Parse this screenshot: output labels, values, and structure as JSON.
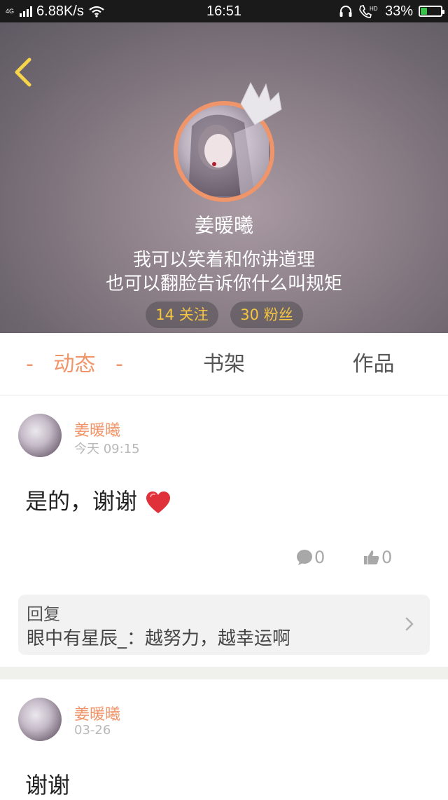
{
  "status_bar": {
    "network": "4G",
    "speed": "6.88K/s",
    "time": "16:51",
    "battery_percent": "33%",
    "battery_level": 0.33,
    "icons": [
      "signal-icon",
      "wifi-icon",
      "headset-icon",
      "hd-call-icon",
      "battery-icon"
    ]
  },
  "profile": {
    "name": "姜暖曦",
    "bio_line1": "我可以笑着和你讲道理",
    "bio_line2": "也可以翻脸告诉你什么叫规矩",
    "follow_label": "14 关注",
    "fans_label": "30 粉丝"
  },
  "tabs": {
    "dash": "-",
    "dongtai": "动态",
    "shujia": "书架",
    "zuopin": "作品",
    "active": "dongtai"
  },
  "posts": [
    {
      "author": "姜暖曦",
      "time": "今天 09:15",
      "text": "是的，谢谢",
      "comments": "0",
      "likes": "0",
      "reply": {
        "label": "回复",
        "content": "眼中有星辰_：越努力，越幸运啊"
      }
    },
    {
      "author": "姜暖曦",
      "time": "03-26",
      "text": "谢谢"
    }
  ],
  "colors": {
    "accent": "#f0956a",
    "pill_text": "#f5c542",
    "back_arrow": "#f7d54a"
  }
}
